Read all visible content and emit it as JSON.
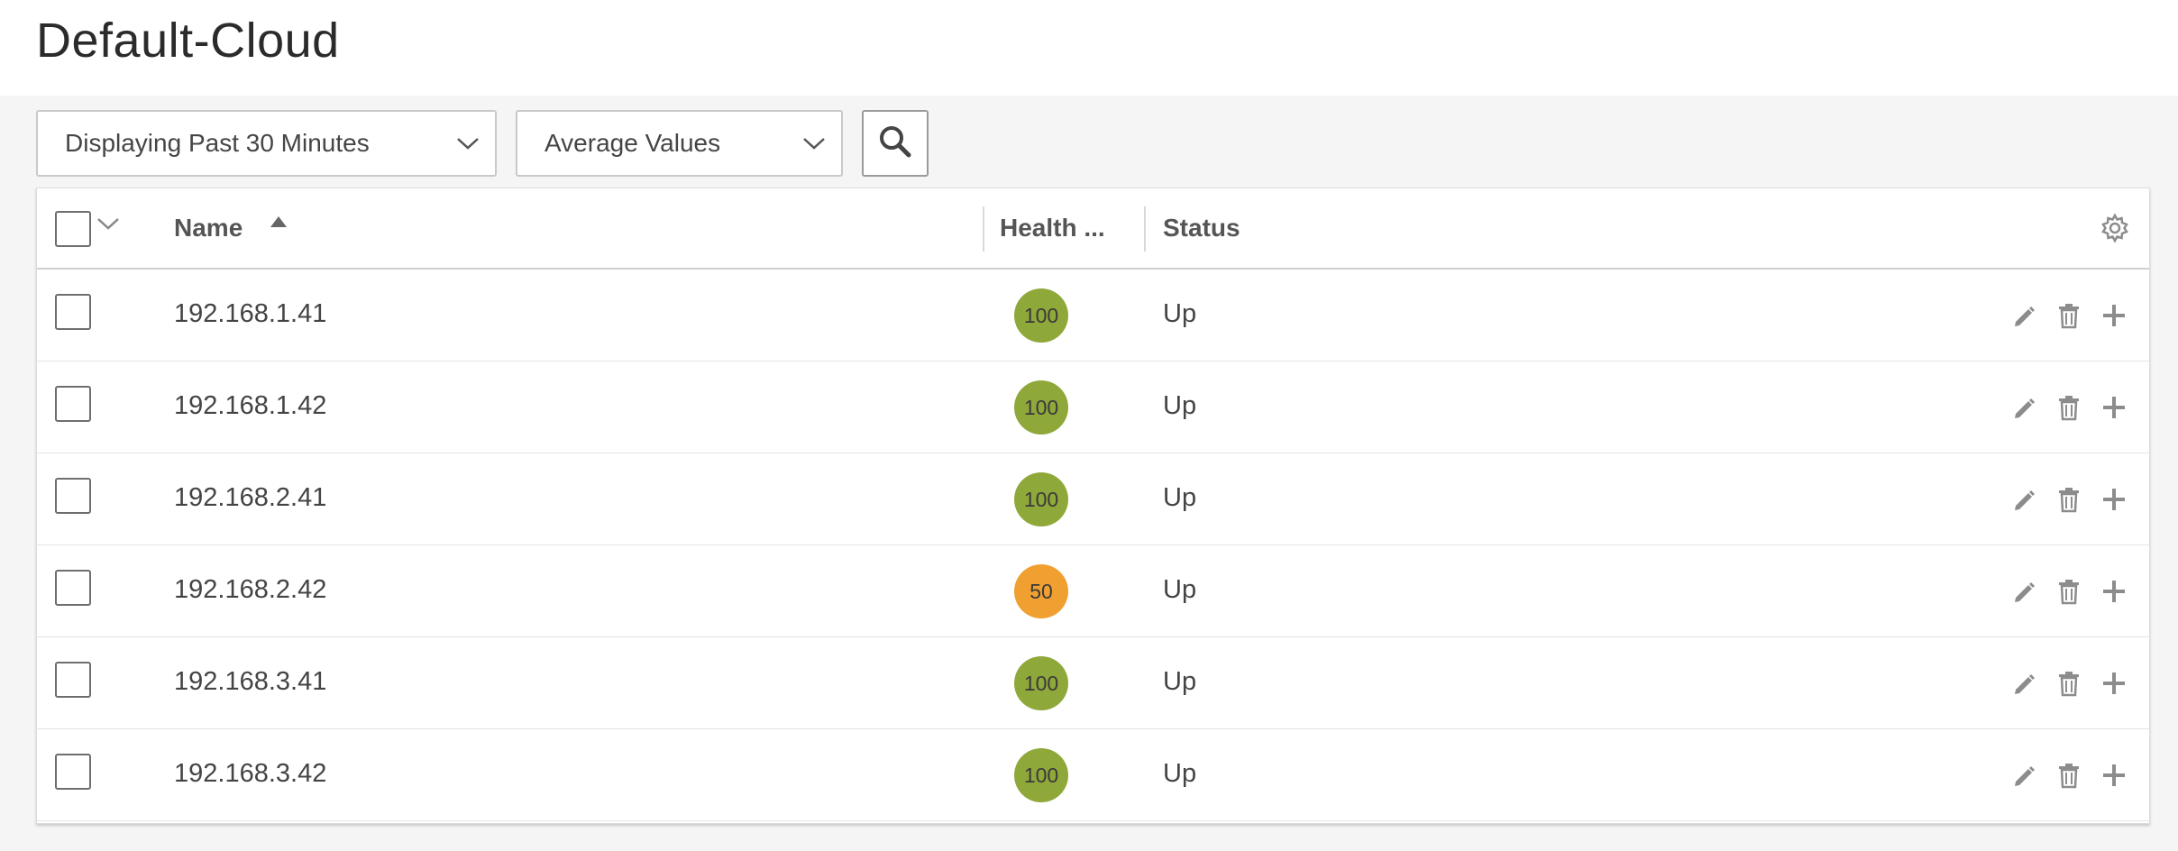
{
  "page": {
    "title": "Default-Cloud"
  },
  "toolbar": {
    "time_range": "Displaying Past 30 Minutes",
    "value_mode": "Average Values",
    "search_icon": "search-icon"
  },
  "table": {
    "columns": {
      "name": "Name",
      "health": "Health ...",
      "status": "Status"
    },
    "sort": {
      "column": "Name",
      "direction": "ascending"
    },
    "rows": [
      {
        "name": "192.168.1.41",
        "health": "100",
        "status": "Up"
      },
      {
        "name": "192.168.1.42",
        "health": "100",
        "status": "Up"
      },
      {
        "name": "192.168.2.41",
        "health": "100",
        "status": "Up"
      },
      {
        "name": "192.168.2.42",
        "health": "50",
        "status": "Up"
      },
      {
        "name": "192.168.3.41",
        "health": "100",
        "status": "Up"
      },
      {
        "name": "192.168.3.42",
        "health": "100",
        "status": "Up"
      }
    ],
    "row_actions": [
      "edit-icon",
      "trash-icon",
      "plus-icon"
    ]
  },
  "colors": {
    "health_good": "#8fa83a",
    "health_warning": "#f0a030",
    "icon_gray": "#8c8c8c"
  }
}
